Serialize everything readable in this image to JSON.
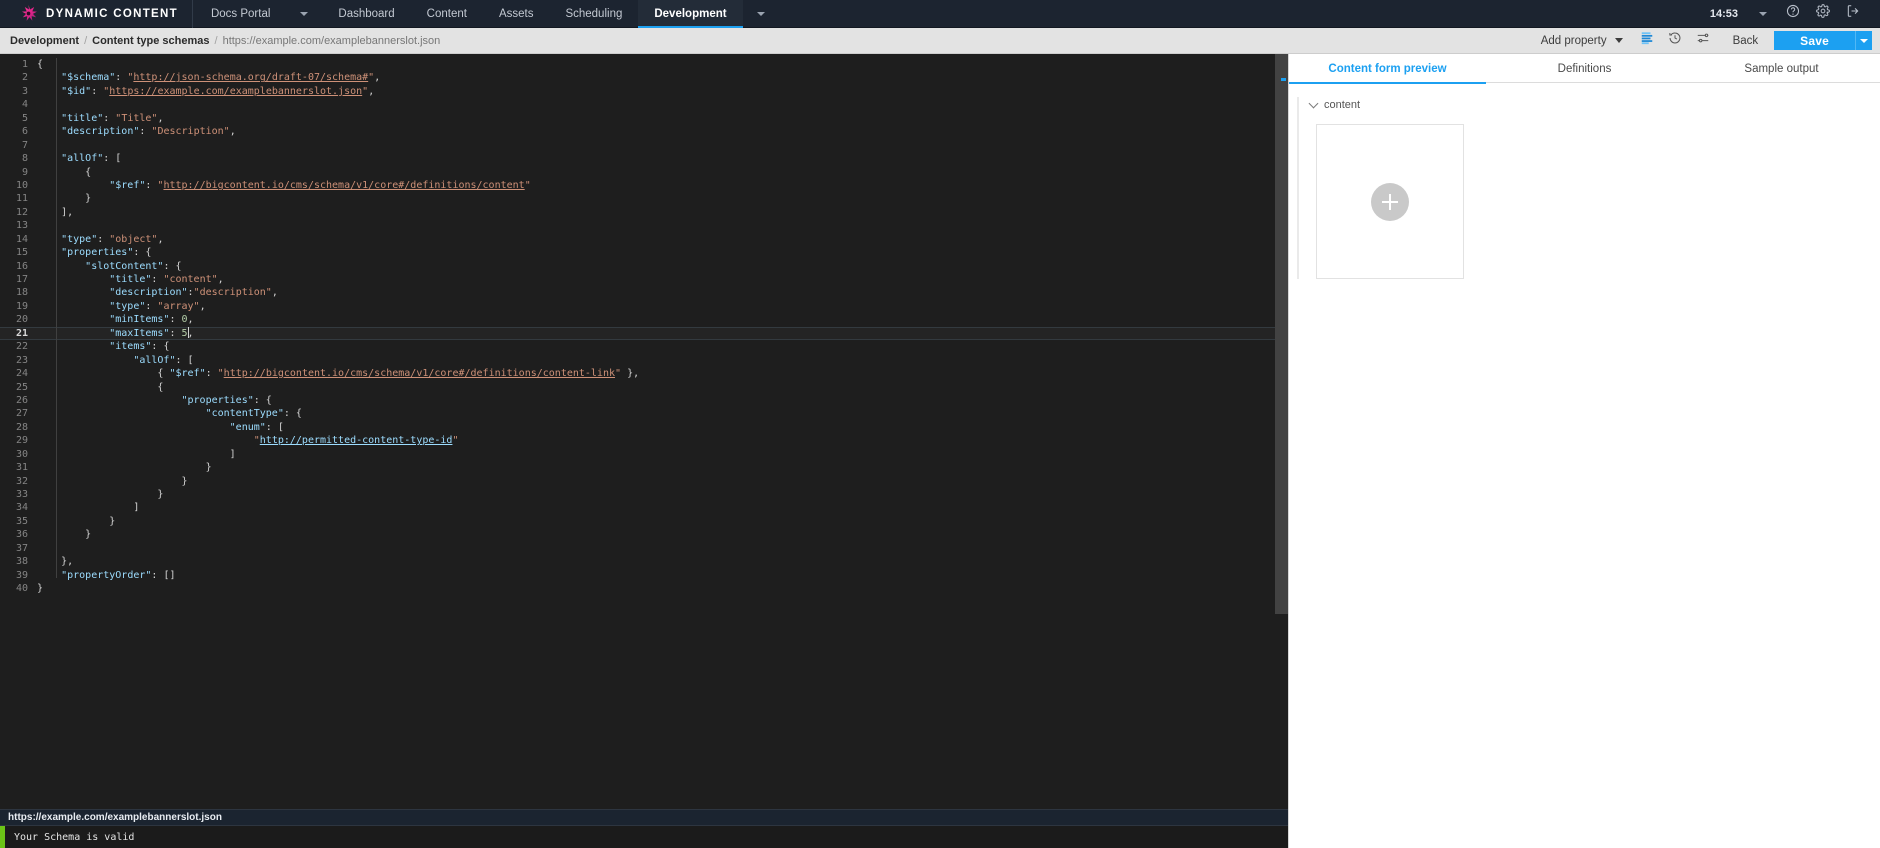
{
  "topnav": {
    "brand": "DYNAMIC CONTENT",
    "logo_icon": "starburst-logo-icon",
    "items": [
      {
        "label": "Docs Portal",
        "active": false,
        "has_caret": true
      },
      {
        "label": "Dashboard",
        "active": false,
        "has_caret": false
      },
      {
        "label": "Content",
        "active": false,
        "has_caret": false
      },
      {
        "label": "Assets",
        "active": false,
        "has_caret": false
      },
      {
        "label": "Scheduling",
        "active": false,
        "has_caret": false
      },
      {
        "label": "Development",
        "active": true,
        "has_caret": true
      }
    ],
    "time": "14:53",
    "help_icon": "help-circle-icon",
    "settings_icon": "gear-icon",
    "logout_icon": "logout-icon",
    "accent": "#1ca0f1",
    "background": "#1c2430"
  },
  "breadcrumb": {
    "root": "Development",
    "section": "Content type schemas",
    "current": "https://example.com/examplebannerslot.json",
    "separator": "/"
  },
  "toolbar": {
    "add_property_label": "Add property",
    "format_icon": "format-lines-icon",
    "history_icon": "history-clock-icon",
    "settings_icon": "sliders-settings-icon",
    "back_label": "Back",
    "save_label": "Save",
    "save_dropdown_icon": "chevron-down-icon",
    "save_color": "#1ca0f1"
  },
  "editor": {
    "active_line": 21,
    "total_lines": 40,
    "lines": [
      {
        "n": 1,
        "html": "<span class=\"p\">{</span>"
      },
      {
        "n": 2,
        "html": "    <span class=\"k\">\"$schema\"</span><span class=\"p\">: </span><span class=\"s\">\"</span><span class=\"u\">http://json-schema.org/draft-07/schema#</span><span class=\"s\">\"</span><span class=\"p\">,</span>"
      },
      {
        "n": 3,
        "html": "    <span class=\"k\">\"$id\"</span><span class=\"p\">: </span><span class=\"s\">\"</span><span class=\"u\">https://example.com/examplebannerslot.json</span><span class=\"s\">\"</span><span class=\"p\">,</span>"
      },
      {
        "n": 4,
        "html": ""
      },
      {
        "n": 5,
        "html": "    <span class=\"k\">\"title\"</span><span class=\"p\">: </span><span class=\"s\">\"Title\"</span><span class=\"p\">,</span>"
      },
      {
        "n": 6,
        "html": "    <span class=\"k\">\"description\"</span><span class=\"p\">: </span><span class=\"s\">\"Description\"</span><span class=\"p\">,</span>"
      },
      {
        "n": 7,
        "html": ""
      },
      {
        "n": 8,
        "html": "    <span class=\"k\">\"allOf\"</span><span class=\"p\">: [</span>"
      },
      {
        "n": 9,
        "html": "        <span class=\"p\">{</span>"
      },
      {
        "n": 10,
        "html": "            <span class=\"k\">\"$ref\"</span><span class=\"p\">: </span><span class=\"s\">\"</span><span class=\"u\">http://bigcontent.io/cms/schema/v1/core#/definitions/content</span><span class=\"s\">\"</span>"
      },
      {
        "n": 11,
        "html": "        <span class=\"p\">}</span>"
      },
      {
        "n": 12,
        "html": "    <span class=\"p\">],</span>"
      },
      {
        "n": 13,
        "html": ""
      },
      {
        "n": 14,
        "html": "    <span class=\"k\">\"type\"</span><span class=\"p\">: </span><span class=\"s\">\"object\"</span><span class=\"p\">,</span>"
      },
      {
        "n": 15,
        "html": "    <span class=\"k\">\"properties\"</span><span class=\"p\">: {</span>"
      },
      {
        "n": 16,
        "html": "        <span class=\"k\">\"slotContent\"</span><span class=\"p\">: {</span>"
      },
      {
        "n": 17,
        "html": "            <span class=\"k\">\"title\"</span><span class=\"p\">: </span><span class=\"s\">\"content\"</span><span class=\"p\">,</span>"
      },
      {
        "n": 18,
        "html": "            <span class=\"k\">\"description\"</span><span class=\"p\">:</span><span class=\"s\">\"description\"</span><span class=\"p\">,</span>"
      },
      {
        "n": 19,
        "html": "            <span class=\"k\">\"type\"</span><span class=\"p\">: </span><span class=\"s\">\"array\"</span><span class=\"p\">,</span>"
      },
      {
        "n": 20,
        "html": "            <span class=\"k\">\"minItems\"</span><span class=\"p\">: </span><span class=\"n\">0</span><span class=\"p\">,</span>"
      },
      {
        "n": 21,
        "html": "            <span class=\"k\">\"maxItems\"</span><span class=\"p\">: </span><span class=\"n\">5</span><span class=\"caret-blink\"></span><span class=\"p\">,</span>"
      },
      {
        "n": 22,
        "html": "            <span class=\"k\">\"items\"</span><span class=\"p\">: {</span>"
      },
      {
        "n": 23,
        "html": "                <span class=\"k\">\"allOf\"</span><span class=\"p\">: [</span>"
      },
      {
        "n": 24,
        "html": "                    <span class=\"p\">{ </span><span class=\"k\">\"$ref\"</span><span class=\"p\">: </span><span class=\"s\">\"</span><span class=\"u\">http://bigcontent.io/cms/schema/v1/core#/definitions/content-link</span><span class=\"s\">\"</span><span class=\"p\"> },</span>"
      },
      {
        "n": 25,
        "html": "                    <span class=\"p\">{</span>"
      },
      {
        "n": 26,
        "html": "                        <span class=\"k\">\"properties\"</span><span class=\"p\">: {</span>"
      },
      {
        "n": 27,
        "html": "                            <span class=\"k\">\"contentType\"</span><span class=\"p\">: {</span>"
      },
      {
        "n": 28,
        "html": "                                <span class=\"k\">\"enum\"</span><span class=\"p\">: [</span>"
      },
      {
        "n": 29,
        "html": "                                    <span class=\"s\">\"</span><span class=\"ub\">http://permitted-content-type-id</span><span class=\"s\">\"</span>"
      },
      {
        "n": 30,
        "html": "                                <span class=\"p\">]</span>"
      },
      {
        "n": 31,
        "html": "                            <span class=\"p\">}</span>"
      },
      {
        "n": 32,
        "html": "                        <span class=\"p\">}</span>"
      },
      {
        "n": 33,
        "html": "                    <span class=\"p\">}</span>"
      },
      {
        "n": 34,
        "html": "                <span class=\"p\">]</span>"
      },
      {
        "n": 35,
        "html": "            <span class=\"p\">}</span>"
      },
      {
        "n": 36,
        "html": "        <span class=\"p\">}</span>"
      },
      {
        "n": 37,
        "html": ""
      },
      {
        "n": 38,
        "html": "    <span class=\"p\">},</span>"
      },
      {
        "n": 39,
        "html": "    <span class=\"k\">\"propertyOrder\"</span><span class=\"p\">: []</span>"
      },
      {
        "n": 40,
        "html": "<span class=\"p\">}</span>"
      }
    ]
  },
  "status": {
    "file_path": "https://example.com/examplebannerslot.json",
    "validation_message": "Your Schema is valid",
    "validation_color": "#6cc417"
  },
  "preview": {
    "tabs": [
      {
        "label": "Content form preview",
        "active": true
      },
      {
        "label": "Definitions",
        "active": false
      },
      {
        "label": "Sample output",
        "active": false
      }
    ],
    "group_label": "content",
    "collapse_icon": "chevron-down-icon",
    "add_card_icon": "plus-circle-icon"
  }
}
